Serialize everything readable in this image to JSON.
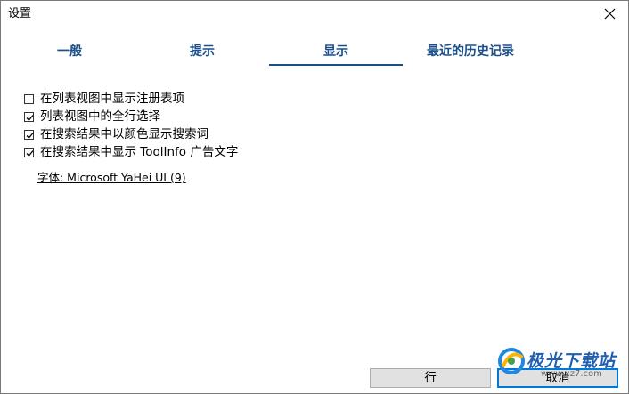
{
  "window": {
    "title": "设置"
  },
  "tabs": [
    {
      "label": "一般",
      "active": false
    },
    {
      "label": "提示",
      "active": false
    },
    {
      "label": "显示",
      "active": true
    },
    {
      "label": "最近的历史记录",
      "active": false
    }
  ],
  "options": [
    {
      "label": "在列表视图中显示注册表项",
      "checked": false
    },
    {
      "label": "列表视图中的全行选择",
      "checked": true
    },
    {
      "label": "在搜索结果中以颜色显示搜索词",
      "checked": true
    },
    {
      "label": "在搜索结果中显示 ToolInfo 广告文字",
      "checked": true
    }
  ],
  "font_link": "字体: Microsoft YaHei UI (9)",
  "buttons": {
    "ok": "行",
    "cancel": "取消"
  },
  "watermark": {
    "text": "极光下载站",
    "sub": "www.xz7.com"
  },
  "colors": {
    "tab_text": "#1a4f8a",
    "accent": "#0078d7"
  }
}
